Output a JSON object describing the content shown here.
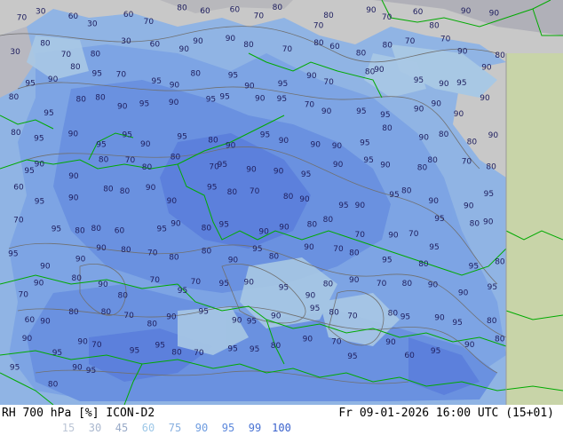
{
  "footer": {
    "title": "RH 700 hPa [%] ICON-D2",
    "time": "Fr 09-01-2026 16:00 UTC (15+01)",
    "legend": [
      {
        "label": "15",
        "color": "#bcc6d6"
      },
      {
        "label": "30",
        "color": "#aab8cf"
      },
      {
        "label": "45",
        "color": "#98aac8"
      },
      {
        "label": "60",
        "color": "#9ec8e8"
      },
      {
        "label": "75",
        "color": "#88b0e0"
      },
      {
        "label": "90",
        "color": "#6e9ce0"
      },
      {
        "label": "95",
        "color": "#5c88dc"
      },
      {
        "label": "99",
        "color": "#4a74d4"
      },
      {
        "label": "100",
        "color": "#3a62cc"
      }
    ]
  },
  "map": {
    "colors": {
      "low": "#c8c8c8",
      "mid": "#a8a8b0",
      "rh60": "#a8c8e4",
      "rh75": "#90b4e4",
      "rh90": "#7ca4e4",
      "rh95": "#6890e0",
      "rh99": "#5a7edc",
      "border": "#00aa00",
      "contour": "#707070",
      "land": "#c8d4a8"
    },
    "contour_labels": [
      "70",
      "30",
      "60",
      "30",
      "60",
      "70",
      "80",
      "60",
      "60",
      "70",
      "80",
      "70",
      "80",
      "90",
      "70",
      "60",
      "80",
      "90",
      "90",
      "30",
      "80",
      "70",
      "80",
      "30",
      "60",
      "90",
      "90",
      "90",
      "80",
      "70",
      "80",
      "60",
      "80",
      "80",
      "70",
      "70",
      "90",
      "80",
      "95",
      "90",
      "80",
      "95",
      "70",
      "95",
      "90",
      "80",
      "95",
      "90",
      "95",
      "90",
      "70",
      "80",
      "90",
      "95",
      "90",
      "95",
      "90",
      "80",
      "95",
      "80",
      "80",
      "90",
      "95",
      "90",
      "95",
      "95",
      "90",
      "95",
      "70",
      "90",
      "95",
      "95",
      "90",
      "90",
      "90",
      "90",
      "80",
      "95",
      "90",
      "95",
      "95",
      "90",
      "95",
      "80",
      "90",
      "95",
      "90",
      "90",
      "90",
      "95",
      "80",
      "90",
      "80",
      "80",
      "90",
      "95",
      "90",
      "90",
      "80",
      "70",
      "80",
      "80",
      "70",
      "95",
      "90",
      "90",
      "95",
      "90",
      "95",
      "90",
      "80",
      "80",
      "70",
      "80",
      "60",
      "95",
      "90",
      "80",
      "80",
      "90",
      "90",
      "95",
      "80",
      "70",
      "80",
      "90",
      "95",
      "90",
      "95",
      "80",
      "90",
      "90",
      "95",
      "70",
      "95",
      "80",
      "80",
      "60",
      "95",
      "90",
      "80",
      "95",
      "90",
      "90",
      "80",
      "80",
      "70",
      "90",
      "70",
      "95",
      "80",
      "90",
      "95",
      "90",
      "90",
      "90",
      "80",
      "70",
      "80",
      "80",
      "90",
      "95",
      "80",
      "90",
      "70",
      "80",
      "95",
      "80",
      "95",
      "95",
      "80",
      "70",
      "90",
      "80",
      "90",
      "80",
      "70",
      "95",
      "70",
      "95",
      "90",
      "95",
      "90",
      "80",
      "90",
      "70",
      "80",
      "90",
      "90",
      "95",
      "60",
      "90",
      "80",
      "80",
      "70",
      "80",
      "90",
      "95",
      "90",
      "95",
      "90",
      "95",
      "80",
      "70",
      "80",
      "95",
      "90",
      "95",
      "80",
      "90",
      "95",
      "90",
      "70",
      "95",
      "95",
      "80",
      "70",
      "95",
      "95",
      "80",
      "90",
      "70",
      "95",
      "90",
      "60",
      "95",
      "90",
      "80",
      "95",
      "80",
      "90",
      "95"
    ]
  }
}
